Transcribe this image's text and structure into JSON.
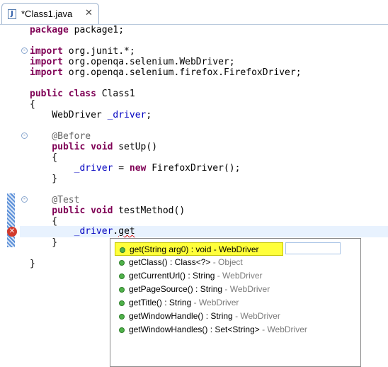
{
  "tab": {
    "title": "*Class1.java",
    "close": "✕",
    "icon_letter": "J"
  },
  "code_lines": [
    [
      "package",
      " package1;"
    ],
    [
      "import",
      " org.junit.*;"
    ],
    [
      "import",
      " org.openqa.selenium.WebDriver;"
    ],
    [
      "import",
      " org.openqa.selenium.firefox.FirefoxDriver;"
    ],
    [
      "public class",
      " Class1"
    ],
    [
      "",
      "{"
    ],
    [
      "",
      "    WebDriver ",
      "_driver",
      ";"
    ],
    [
      "@Before"
    ],
    [
      "public void",
      " setUp()"
    ],
    [
      "",
      "    {"
    ],
    [
      "",
      "        ",
      "_driver",
      " = ",
      "new",
      " FirefoxDriver();"
    ],
    [
      "",
      "    }"
    ],
    [
      "@Test"
    ],
    [
      "public void",
      " testMethod()"
    ],
    [
      "",
      "    {"
    ],
    [
      "",
      "        _driver.get"
    ],
    [
      "",
      "    }"
    ],
    [
      "",
      "}"
    ]
  ],
  "editor": {
    "l_package_kw": "package",
    "l_package_rest": " package1;",
    "l_imp1_kw": "import",
    "l_imp1_rest": " org.junit.*;",
    "l_imp2_kw": "import",
    "l_imp2_rest": " org.openqa.selenium.WebDriver;",
    "l_imp3_kw": "import",
    "l_imp3_rest": " org.openqa.selenium.firefox.FirefoxDriver;",
    "l_class_kw": "public class",
    "l_class_rest": " Class1",
    "l_open1": "{",
    "l_field_type": "    WebDriver ",
    "l_field_name": "_driver",
    "l_field_end": ";",
    "l_before": "    @Before",
    "l_setup_kw": "    public void",
    "l_setup_rest": " setUp()",
    "l_open2": "    {",
    "l_assign_pre": "        ",
    "l_assign_fld": "_driver",
    "l_assign_eq": " = ",
    "l_assign_new": "new",
    "l_assign_rest": " FirefoxDriver();",
    "l_close2": "    }",
    "l_test": "    @Test",
    "l_tm_kw": "    public void",
    "l_tm_rest": " testMethod()",
    "l_open3": "    {",
    "l_call_pre": "        ",
    "l_call_fld": "_driver",
    "l_call_dot": ".",
    "l_call_get": "get",
    "l_close3": "    }",
    "l_close1": "}"
  },
  "completion": {
    "items": [
      {
        "sig": "get(String arg0) : void",
        "owner": " - WebDriver",
        "selected": true
      },
      {
        "sig": "getClass() : Class<?>",
        "owner": " - Object"
      },
      {
        "sig": "getCurrentUrl() : String",
        "owner": " - WebDriver"
      },
      {
        "sig": "getPageSource() : String",
        "owner": " - WebDriver"
      },
      {
        "sig": "getTitle() : String",
        "owner": " - WebDriver"
      },
      {
        "sig": "getWindowHandle() : String",
        "owner": " - WebDriver"
      },
      {
        "sig": "getWindowHandles() : Set<String>",
        "owner": " - WebDriver"
      }
    ]
  },
  "colors": {
    "keyword": "#7f0055",
    "annotation": "#646464",
    "field": "#0000c0",
    "selection": "#ffff3a",
    "method_icon": "#4fb24a",
    "error": "#d33a2c"
  }
}
